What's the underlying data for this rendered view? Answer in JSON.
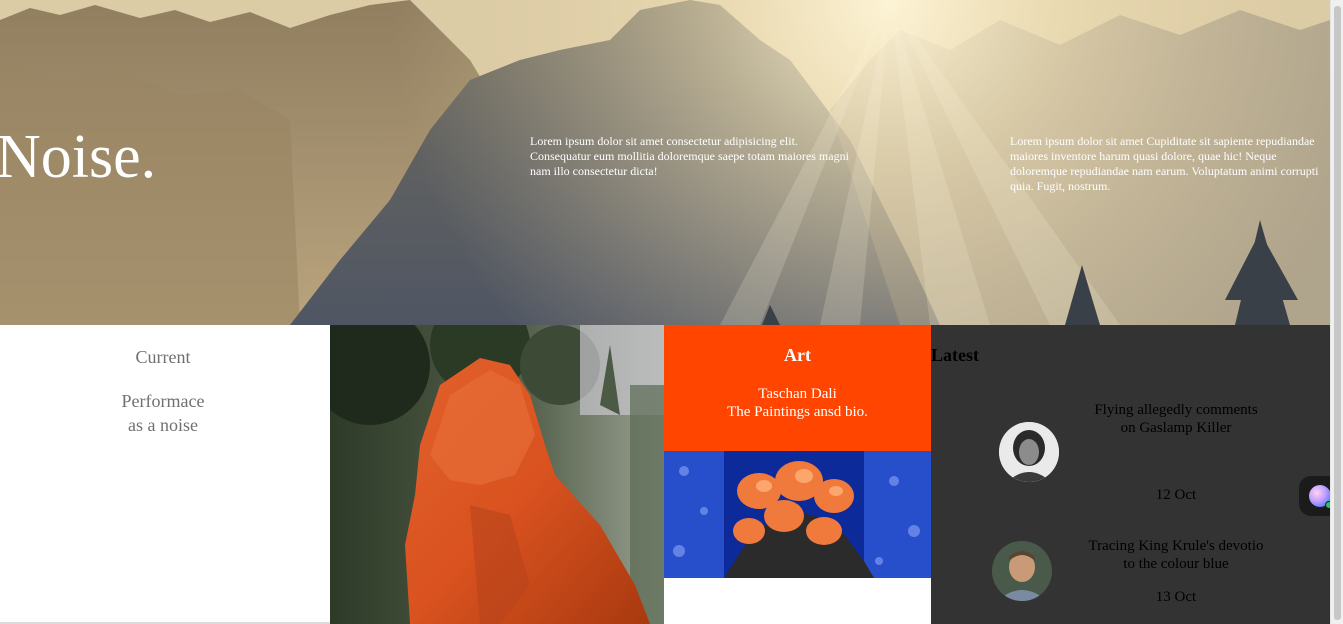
{
  "hero": {
    "title": "Noise.",
    "text_1": "Lorem ipsum dolor sit amet consectetur adipisicing elit. Consequatur eum mollitia doloremque saepe totam maiores magni nam illo consectetur dicta!",
    "text_2": "Lorem ipsum dolor sit amet Cupiditate sit sapiente repudiandae maiores inventore harum quasi dolore, quae hic! Neque doloremque repudiandae nam earum. Voluptatum animi corrupti quia. Fugit, nostrum."
  },
  "current": {
    "heading": "Current",
    "line_1": "Performace",
    "line_2": "as a noise"
  },
  "art": {
    "title": "Art",
    "subtitle_1": "Taschan Dali",
    "subtitle_2": "The Paintings ansd bio."
  },
  "latest": {
    "heading": "Latest",
    "items": [
      {
        "title_1": "Flying allegedly comments",
        "title_2": "on Gaslamp Killer",
        "date": "12 Oct"
      },
      {
        "title_1": "Tracing King Krule's devotio",
        "title_2": "to the colour blue",
        "date": "13 Oct"
      }
    ]
  },
  "colors": {
    "accent_orange": "#ff4500",
    "dark_panel": "#333333"
  }
}
